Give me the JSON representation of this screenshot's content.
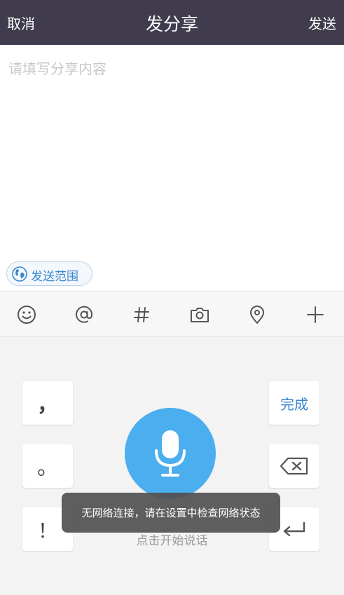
{
  "header": {
    "cancel_label": "取消",
    "title": "发分享",
    "send_label": "发送"
  },
  "editor": {
    "placeholder": "请填写分享内容"
  },
  "scope": {
    "label": "发送范围",
    "icon": "globe-icon"
  },
  "toolbar": {
    "icons": [
      "emoji-icon",
      "at-icon",
      "hashtag-icon",
      "camera-icon",
      "location-icon",
      "plus-icon"
    ]
  },
  "keyboard": {
    "comma_key": "，",
    "period_key": "。",
    "exclaim_key": "！",
    "done_label": "完成",
    "delete_icon": "backspace-icon",
    "enter_icon": "enter-icon",
    "mic_icon": "microphone-icon",
    "hint": "点击开始说话"
  },
  "toast": {
    "message": "无网络连接，请在设置中检查网络状态"
  },
  "colors": {
    "header_bg": "#403b4d",
    "accent": "#3a86cf",
    "mic_bg": "#4aaeef"
  }
}
